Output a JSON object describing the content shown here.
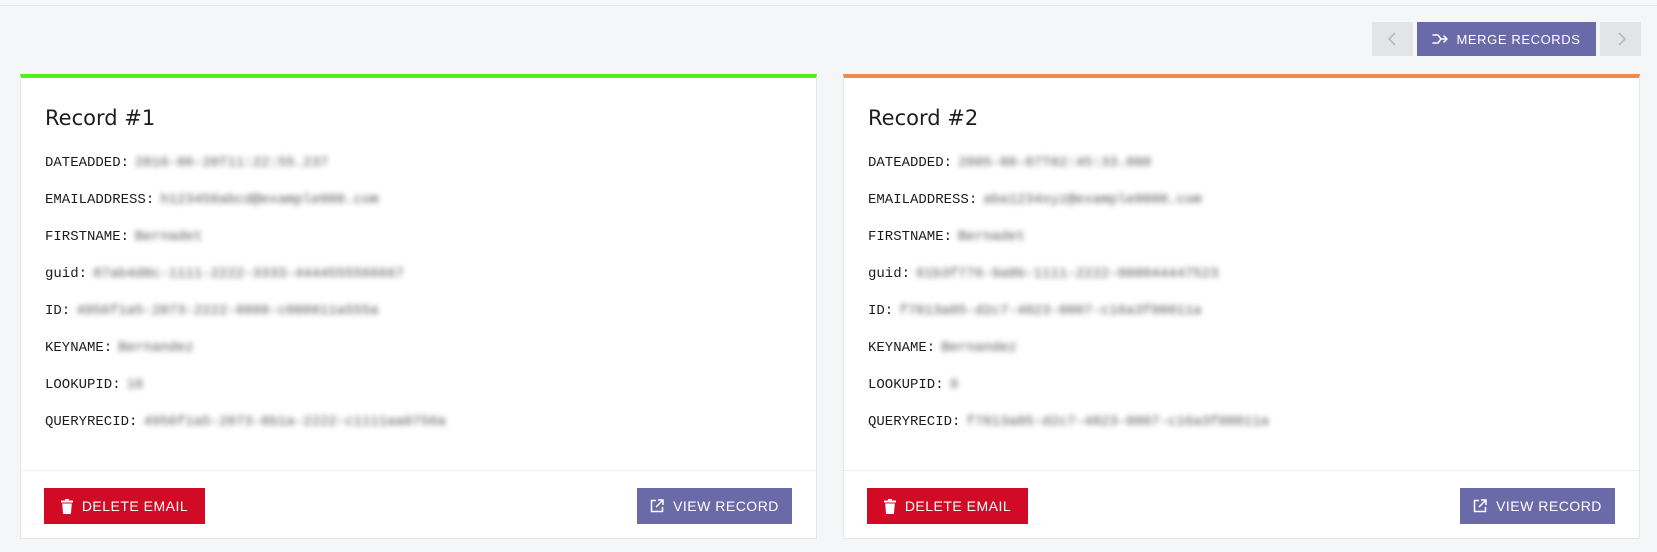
{
  "toolbar": {
    "prev_icon": "chevron-left-icon",
    "next_icon": "chevron-right-icon",
    "merge_label": "MERGE RECORDS",
    "merge_icon": "merge-arrow-icon"
  },
  "colors": {
    "accent": "#6a6aa8",
    "danger": "#d10a25",
    "record1_border": "#55ee19",
    "record2_border": "#f08a4a",
    "nav_button_bg": "#e2e4e7"
  },
  "records": [
    {
      "title": "Record #1",
      "fields": [
        {
          "key": "DATEADDED:",
          "value": "2016-06-20T11:22:55.237"
        },
        {
          "key": "EMAILADDRESS:",
          "value": "h123456abcd@example000.com"
        },
        {
          "key": "FIRSTNAME:",
          "value": "Bernadet"
        },
        {
          "key": "guid:",
          "value": "87ab4d0c-1111-2222-3333-4444555566667"
        },
        {
          "key": "ID:",
          "value": "4956f1a5-2073-2222-8888-c000811a555a"
        },
        {
          "key": "KEYNAME:",
          "value": "Bernandez"
        },
        {
          "key": "LOOKUPID:",
          "value": "16"
        },
        {
          "key": "QUERYRECID:",
          "value": "4956f1a5-2073-8b1a-2222-c1111aa0756a"
        }
      ],
      "delete_label": "DELETE EMAIL",
      "view_label": "VIEW RECORD"
    },
    {
      "title": "Record #2",
      "fields": [
        {
          "key": "DATEADDED:",
          "value": "2005-08-07T02:45:33.000"
        },
        {
          "key": "EMAILADDRESS:",
          "value": "aba1234xyz@example0000.com"
        },
        {
          "key": "FIRSTNAME:",
          "value": "Bernadet"
        },
        {
          "key": "guid:",
          "value": "61b3f776-9a0b-1111-2222-000044447523"
        },
        {
          "key": "ID:",
          "value": "f7813a05-d2c7-4023-0007-c16a3f00011a"
        },
        {
          "key": "KEYNAME:",
          "value": "Bernandez"
        },
        {
          "key": "LOOKUPID:",
          "value": "9"
        },
        {
          "key": "QUERYRECID:",
          "value": "f7813a05-d2c7-4023-0007-c16a3f00011a"
        }
      ],
      "delete_label": "DELETE EMAIL",
      "view_label": "VIEW RECORD"
    }
  ]
}
